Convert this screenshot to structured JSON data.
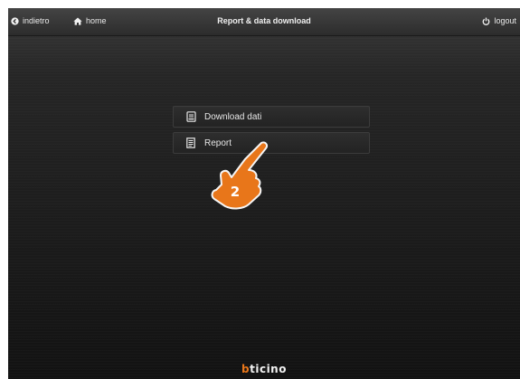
{
  "topbar": {
    "back_label": "indietro",
    "home_label": "home",
    "title": "Report & data download",
    "logout_label": "logout"
  },
  "menu": {
    "items": [
      {
        "label": "Download dati",
        "icon": "download-document-icon"
      },
      {
        "label": "Report",
        "icon": "report-document-icon"
      }
    ]
  },
  "annotation": {
    "step_number": "2",
    "color": "#e8761a"
  },
  "brand": {
    "prefix": "b",
    "rest": "ticino"
  }
}
